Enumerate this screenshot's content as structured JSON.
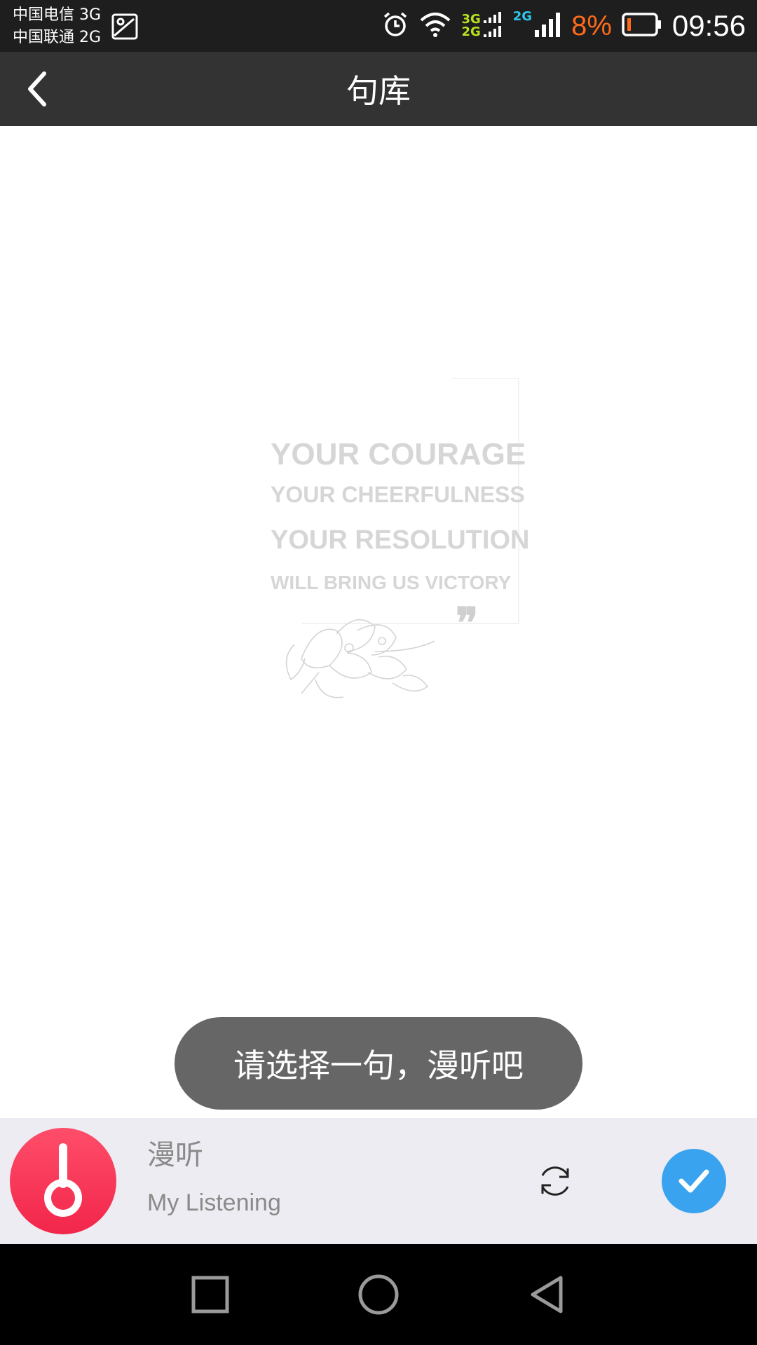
{
  "status_bar": {
    "carrier_1": "中国电信 3G",
    "carrier_2": "中国联通 2G",
    "net_tag_1_top": "3G",
    "net_tag_1_bottom": "2G",
    "net_tag_2": "2G",
    "battery_percent": "8%",
    "time": "09:56",
    "icons": [
      "gallery-icon",
      "alarm-icon",
      "wifi-icon",
      "signal-icon",
      "battery-icon"
    ]
  },
  "app_bar": {
    "title": "句库",
    "back_icon": "chevron-left-icon"
  },
  "content": {
    "quote_lines": [
      "YOUR COURAGE",
      "YOUR CHEERFULNESS",
      "YOUR RESOLUTION",
      "WILL BRING US VICTORY"
    ],
    "quote_mark": "❞"
  },
  "toast": {
    "message": "请选择一句，漫听吧"
  },
  "player": {
    "title": "漫听",
    "subtitle": "My Listening",
    "logo_icon": "headphones-icon",
    "refresh_icon": "refresh-icon",
    "confirm_icon": "check-icon",
    "colors": {
      "logo": "#f2264a",
      "confirm": "#3aa3ef",
      "background": "#ececf2"
    }
  },
  "nav_bar": {
    "icons": [
      "square-recents-icon",
      "circle-home-icon",
      "triangle-back-icon"
    ]
  }
}
